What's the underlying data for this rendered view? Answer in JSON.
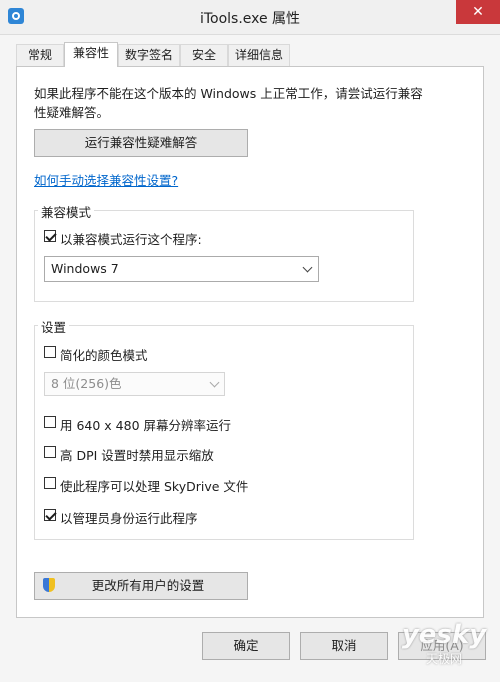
{
  "window": {
    "title": "iTools.exe 属性",
    "close_symbol": "✕"
  },
  "tabs": [
    {
      "label": "常规"
    },
    {
      "label": "兼容性",
      "active": true
    },
    {
      "label": "数字签名"
    },
    {
      "label": "安全"
    },
    {
      "label": "详细信息"
    }
  ],
  "intro_text": "如果此程序不能在这个版本的 Windows 上正常工作，请尝试运行兼容性疑难解答。",
  "troubleshooter_button": "运行兼容性疑难解答",
  "manual_link": "如何手动选择兼容性设置?",
  "compat_mode": {
    "title": "兼容模式",
    "checkbox_label": "以兼容模式运行这个程序:",
    "checked": true,
    "os_value": "Windows 7"
  },
  "settings": {
    "title": "设置",
    "reduced_color_label": "简化的颜色模式",
    "color_value": "8 位(256)色",
    "res_640_label": "用 640 x 480 屏幕分辨率运行",
    "dpi_label": "高 DPI 设置时禁用显示缩放",
    "skydrive_label": "使此程序可以处理 SkyDrive 文件",
    "admin_label": "以管理员身份运行此程序",
    "admin_checked": true
  },
  "all_users_button": "更改所有用户的设置",
  "footer": {
    "ok": "确定",
    "cancel": "取消",
    "apply": "应用(A)"
  },
  "watermark": {
    "logo": "yesky",
    "subtitle": "天极网"
  },
  "colors": {
    "link": "#0066cc",
    "close": "#c9383b"
  }
}
